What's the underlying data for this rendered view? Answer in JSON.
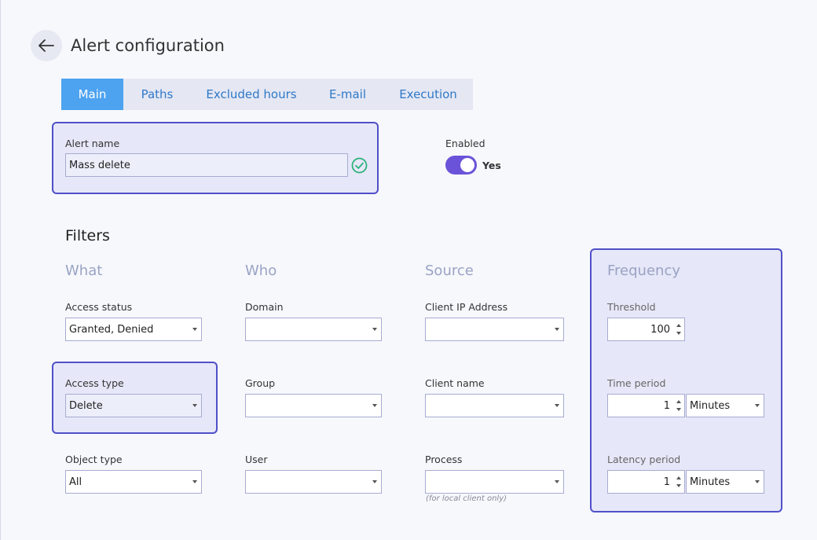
{
  "header": {
    "title": "Alert configuration"
  },
  "tabs": [
    {
      "label": "Main",
      "active": true
    },
    {
      "label": "Paths",
      "active": false
    },
    {
      "label": "Excluded hours",
      "active": false
    },
    {
      "label": "E-mail",
      "active": false
    },
    {
      "label": "Execution",
      "active": false
    }
  ],
  "alert_name": {
    "label": "Alert name",
    "value": "Mass delete",
    "valid_icon": "check-circle-icon"
  },
  "enabled": {
    "label": "Enabled",
    "state_label": "Yes",
    "on": true
  },
  "filters": {
    "title": "Filters",
    "what": {
      "heading": "What",
      "access_status": {
        "label": "Access status",
        "value": "Granted, Denied"
      },
      "access_type": {
        "label": "Access type",
        "value": "Delete"
      },
      "object_type": {
        "label": "Object type",
        "value": "All"
      }
    },
    "who": {
      "heading": "Who",
      "domain": {
        "label": "Domain",
        "value": ""
      },
      "group": {
        "label": "Group",
        "value": ""
      },
      "user": {
        "label": "User",
        "value": ""
      }
    },
    "source": {
      "heading": "Source",
      "client_ip": {
        "label": "Client IP Address",
        "value": ""
      },
      "client_name": {
        "label": "Client name",
        "value": ""
      },
      "process": {
        "label": "Process",
        "value": "",
        "hint": "(for local client only)"
      }
    },
    "frequency": {
      "heading": "Frequency",
      "threshold": {
        "label": "Threshold",
        "value": "100"
      },
      "time_period": {
        "label": "Time period",
        "value": "1",
        "unit": "Minutes"
      },
      "latency_period": {
        "label": "Latency period",
        "value": "1",
        "unit": "Minutes"
      }
    }
  },
  "colors": {
    "accent": "#4da3f0",
    "highlight_border": "#5050c8",
    "toggle": "#6a53d8",
    "valid": "#2db37a"
  }
}
